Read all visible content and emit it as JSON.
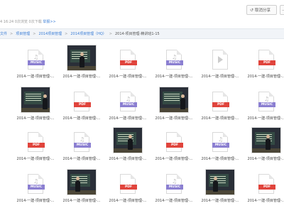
{
  "header": {
    "meta_prefix": "4 16:24 0次浏览 0次下载 ",
    "report_link": "举报>>",
    "cancel_share_label": "取消分享",
    "more_label": "..."
  },
  "breadcrumb": {
    "items": [
      "文件",
      "项目管理",
      "2014项目管理",
      "2014项目管理（HQ）",
      "2014-项目管理-精讲班1-15"
    ],
    "separator": ">"
  },
  "files": [
    {
      "type": "music",
      "label": "2014-一建-项目管理-..."
    },
    {
      "type": "photo",
      "label": "2014-一建-项目管理-..."
    },
    {
      "type": "pdf",
      "label": "2014-一建-项目管理-..."
    },
    {
      "type": "music",
      "label": "2014-一建-项目管理-..."
    },
    {
      "type": "video",
      "label": "2014-一建-项目管理-..."
    },
    {
      "type": "pdf",
      "label": "2014-一建-项目管理-..."
    },
    {
      "type": "photo",
      "label": "2014-一建-项目管理-..."
    },
    {
      "type": "pdf",
      "label": "2014-一建-项目管理-..."
    },
    {
      "type": "music",
      "label": "2014-一建-项目管理-..."
    },
    {
      "type": "photo",
      "label": "2014-一建-项目管理-..."
    },
    {
      "type": "pdf",
      "label": "2014-一建-项目管理-..."
    },
    {
      "type": "music",
      "label": "2014-一建-项目管理-..."
    },
    {
      "type": "pdf",
      "label": "2014-一建-项目管理-..."
    },
    {
      "type": "music",
      "label": "2014-一建-项目管理-..."
    },
    {
      "type": "photo",
      "label": "2014-一建-项目管理-..."
    },
    {
      "type": "pdf",
      "label": "2014-一建-项目管理-..."
    },
    {
      "type": "music",
      "label": "2014-一建-项目管理-..."
    },
    {
      "type": "photo",
      "label": "2014-一建-项目管理-..."
    },
    {
      "type": "music",
      "label": "2014-一建-项目管理-..."
    },
    {
      "type": "photo",
      "label": "2014-一建-项目管理-..."
    },
    {
      "type": "pdf",
      "label": "2014-一建-项目管理-..."
    },
    {
      "type": "music",
      "label": "2014-一建-项目管理-..."
    },
    {
      "type": "photo",
      "label": "2014-一建-项目管理-..."
    },
    {
      "type": "pdf",
      "label": "2014-一建-项目管理-..."
    }
  ]
}
